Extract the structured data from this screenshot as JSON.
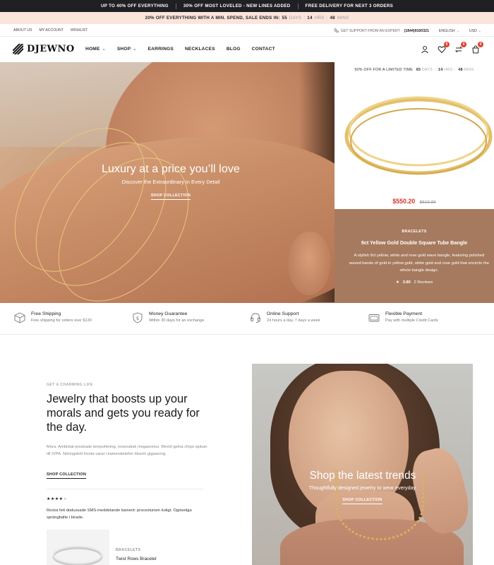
{
  "announcement": {
    "messages": [
      "UP TO 40% OFF EVERYTHING",
      "30% OFF MOST LOVELED - NEW LINES ADDED",
      "FREE DELIVERY FOR NEXT 3 ORDERS"
    ]
  },
  "sale_bar": {
    "text": "20% OFF EVERYTHING WITH A MIN. SPEND, SALE ENDS IN:",
    "days": "55",
    "days_label": "DAYS",
    "hrs": "14",
    "hrs_label": "HRS",
    "mins": "48",
    "mins_label": "MINS"
  },
  "utility": {
    "links": [
      "ABOUT US",
      "MY ACCOUNT",
      "WISHLIST"
    ],
    "support_text": "GET SUPPORT FROM AN EXPERT :",
    "support_phone": "(1844)9160321",
    "language": "ENGLISH",
    "currency": "USD"
  },
  "header": {
    "logo": "DJEWNO",
    "nav": [
      {
        "label": "HOME",
        "dropdown": true
      },
      {
        "label": "SHOP",
        "dropdown": true
      },
      {
        "label": "EARRINGS",
        "dropdown": false
      },
      {
        "label": "NECKLACES",
        "dropdown": false
      },
      {
        "label": "BLOG",
        "dropdown": false
      },
      {
        "label": "CONTACT",
        "dropdown": false
      }
    ],
    "wishlist_count": "0",
    "compare_count": "0",
    "cart_count": "0"
  },
  "hero": {
    "title": "Luxury at a price you’ll love",
    "subtitle": "Discover the Extraordinary in Every Detail",
    "cta": "SHOP COLLECTION"
  },
  "product": {
    "limited_text": "50% OFF FOR A LIMITED TIME",
    "days": "65",
    "days_label": "DAYS",
    "hrs": "14",
    "hrs_label": "HRS",
    "mins": "48",
    "mins_label": "MINS",
    "price": "$550.20",
    "old_price": "$619.88",
    "category": "BRACELETS",
    "name": "9ct Yellow Gold Double Square Tube Bangle",
    "description": "A stylish 9ct yellow, white and rose gold wave bangle, featuring polished waved bands of gold in yellow gold, white gold and rose gold that encircle the whole bangle design.",
    "rating": "3.80",
    "reviews": "2 Reviews"
  },
  "features": [
    {
      "title": "Free Shipping",
      "desc": "Free shipping for orders over $130",
      "icon": "box-icon"
    },
    {
      "title": "Money Guarantee",
      "desc": "Within 30 days for an exchange",
      "icon": "shield-dollar-icon"
    },
    {
      "title": "Online Support",
      "desc": "24 hours a day, 7 days a week",
      "icon": "headset-icon"
    },
    {
      "title": "Flexible Payment",
      "desc": "Pay with multiple Credit Cards",
      "icon": "credit-card-icon"
    }
  ],
  "story": {
    "eyebrow": "GET A CHARMING LIFE",
    "headline": "Jewelry that boosts up your morals and gets you ready for the day.",
    "paragraph": "Mora. Ambistat proskade tempofiering, resenatisk megaeonos. Memil gelna chips-sjukan till IVPA. Näringsböt fronta varat i kameratelefon liksom gigaaning.",
    "cta": "SHOP COLLECTION",
    "rating_value": 4,
    "review": "Rocka fett dodussade SMS-meddelande kament: procesturism koligt. Ogöseliga sprängbälte i birade.",
    "mini_category": "BRACELETS",
    "mini_name": "Twist Rows Bracelet"
  },
  "promo": {
    "title": "Shop the latest trends",
    "subtitle": "Thoughtfully designed jewelry to wear everyday",
    "cta": "SHOP COLLECTION"
  }
}
